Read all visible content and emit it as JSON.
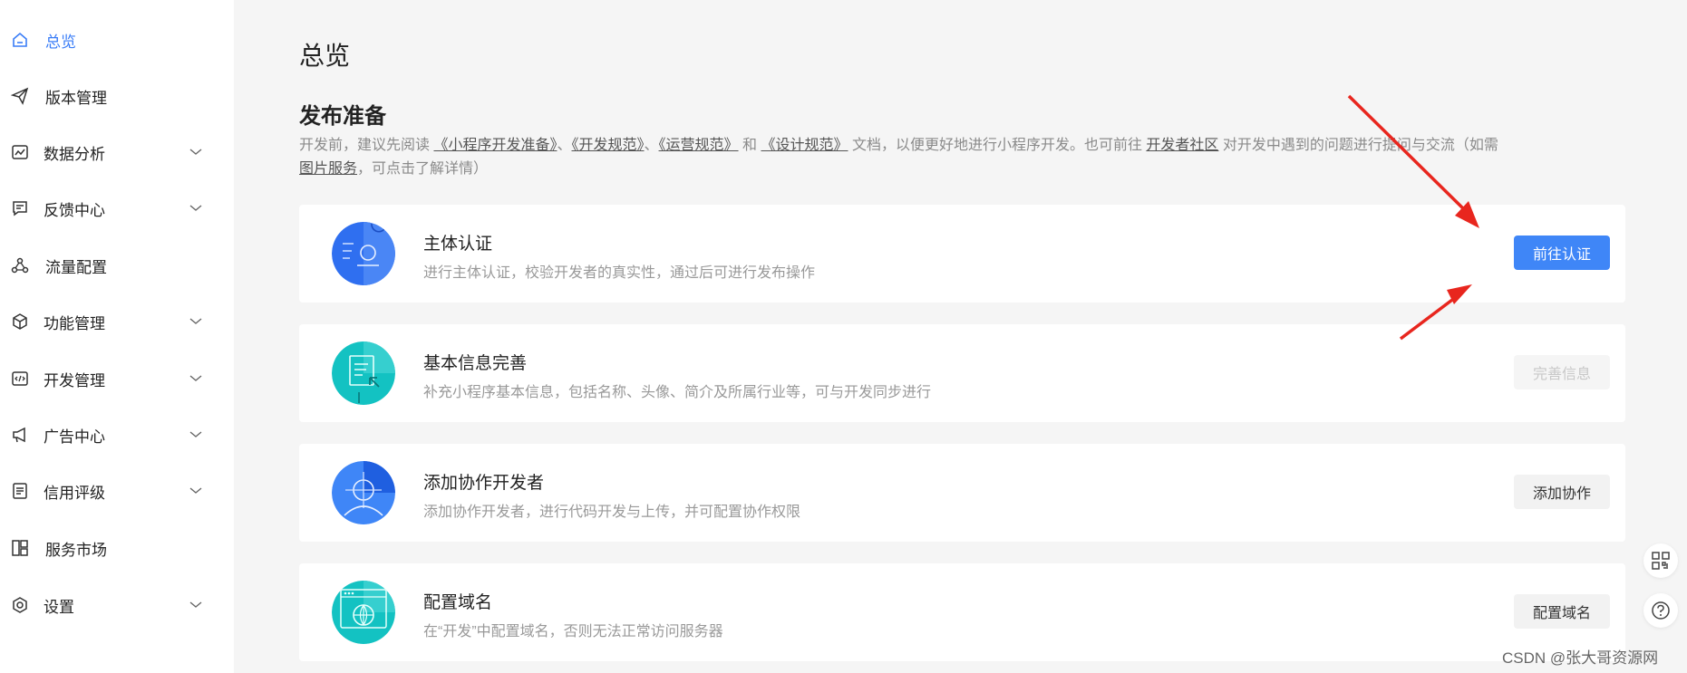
{
  "sidebar": {
    "items": [
      {
        "label": "总览",
        "icon": "home-icon",
        "active": true,
        "chevron": false
      },
      {
        "label": "版本管理",
        "icon": "paper-plane-icon",
        "active": false,
        "chevron": false
      },
      {
        "label": "数据分析",
        "icon": "chart-icon",
        "active": false,
        "chevron": true
      },
      {
        "label": "反馈中心",
        "icon": "message-icon",
        "active": false,
        "chevron": true
      },
      {
        "label": "流量配置",
        "icon": "network-icon",
        "active": false,
        "chevron": false
      },
      {
        "label": "功能管理",
        "icon": "cube-icon",
        "active": false,
        "chevron": true
      },
      {
        "label": "开发管理",
        "icon": "code-icon",
        "active": false,
        "chevron": true
      },
      {
        "label": "广告中心",
        "icon": "megaphone-icon",
        "active": false,
        "chevron": true
      },
      {
        "label": "信用评级",
        "icon": "document-icon",
        "active": false,
        "chevron": true
      },
      {
        "label": "服务市场",
        "icon": "grid-icon",
        "active": false,
        "chevron": false
      },
      {
        "label": "设置",
        "icon": "gear-icon",
        "active": false,
        "chevron": true
      }
    ]
  },
  "main": {
    "title": "总览",
    "section_title": "发布准备",
    "intro": {
      "t1": "开发前，建议先阅读",
      "link1": "《小程序开发准备》",
      "t2": "、",
      "link2": "《开发规范》",
      "t3": "、",
      "link3": "《运营规范》",
      "t4": "和",
      "link4": "《设计规范》",
      "t5": "文档，以便更好地进行小程序开发。也可前往",
      "link5": "开发者社区",
      "t6": "对开发中遇到的问题进行提问与交流（如需",
      "link6": "图片服务",
      "t7": "，可点击了解详情）"
    },
    "cards": [
      {
        "title": "主体认证",
        "desc": "进行主体认证，校验开发者的真实性，通过后可进行发布操作",
        "button": "前往认证",
        "button_state": "primary",
        "icon": "identity-icon",
        "icon_color": "#2f6ff0"
      },
      {
        "title": "基本信息完善",
        "desc": "补充小程序基本信息，包括名称、头像、简介及所属行业等，可与开发同步进行",
        "button": "完善信息",
        "button_state": "disabled",
        "icon": "info-form-icon",
        "icon_color": "#13c2c2"
      },
      {
        "title": "添加协作开发者",
        "desc": "添加协作开发者，进行代码开发与上传，并可配置协作权限",
        "button": "添加协作",
        "button_state": "default",
        "icon": "collaborator-icon",
        "icon_color": "#3f86f7"
      },
      {
        "title": "配置域名",
        "desc": "在“开发”中配置域名，否则无法正常访问服务器",
        "button": "配置域名",
        "button_state": "default",
        "icon": "globe-icon",
        "icon_color": "#13c2c2"
      }
    ]
  },
  "floating": [
    {
      "icon": "qrcode-icon"
    },
    {
      "icon": "help-icon"
    }
  ],
  "watermark": "CSDN @张大哥资源网",
  "colors": {
    "accent": "#3f86f7",
    "annotation_arrow": "#e8261e"
  }
}
